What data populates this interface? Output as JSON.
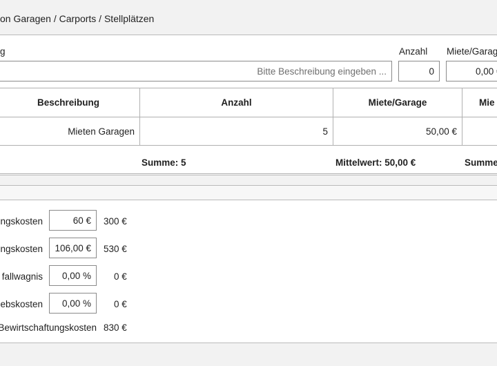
{
  "section": {
    "title": "on Garagen / Carports / Stellplätzen"
  },
  "entry_form": {
    "description_label": "g",
    "description_placeholder": "Bitte Beschreibung eingeben ...",
    "count_label": "Anzahl",
    "count_value": "0",
    "rent_label": "Miete/Garag",
    "rent_value": "0,00 €"
  },
  "table": {
    "headers": [
      "Beschreibung",
      "Anzahl",
      "Miete/Garage",
      "Mie"
    ],
    "rows": [
      {
        "description": "Mieten Garagen",
        "count": "5",
        "rent": "50,00 €",
        "extra": ""
      }
    ],
    "summary": {
      "count_sum": "Summe: 5",
      "rent_mean": "Mittelwert: 50,00 €",
      "extra": "Summe"
    }
  },
  "costs": {
    "items": [
      {
        "label": "ngskosten",
        "input": "60 €",
        "result": "300 €"
      },
      {
        "label": "ngskosten",
        "input": "106,00 €",
        "result": "530 €"
      },
      {
        "label": "fallwagnis",
        "input": "0,00 %",
        "result": "0 €"
      },
      {
        "label": "ebskosten",
        "input": "0,00 %",
        "result": "0 €"
      }
    ],
    "total_label": "Bewirtschaftungskosten",
    "total_value": "830 €"
  }
}
